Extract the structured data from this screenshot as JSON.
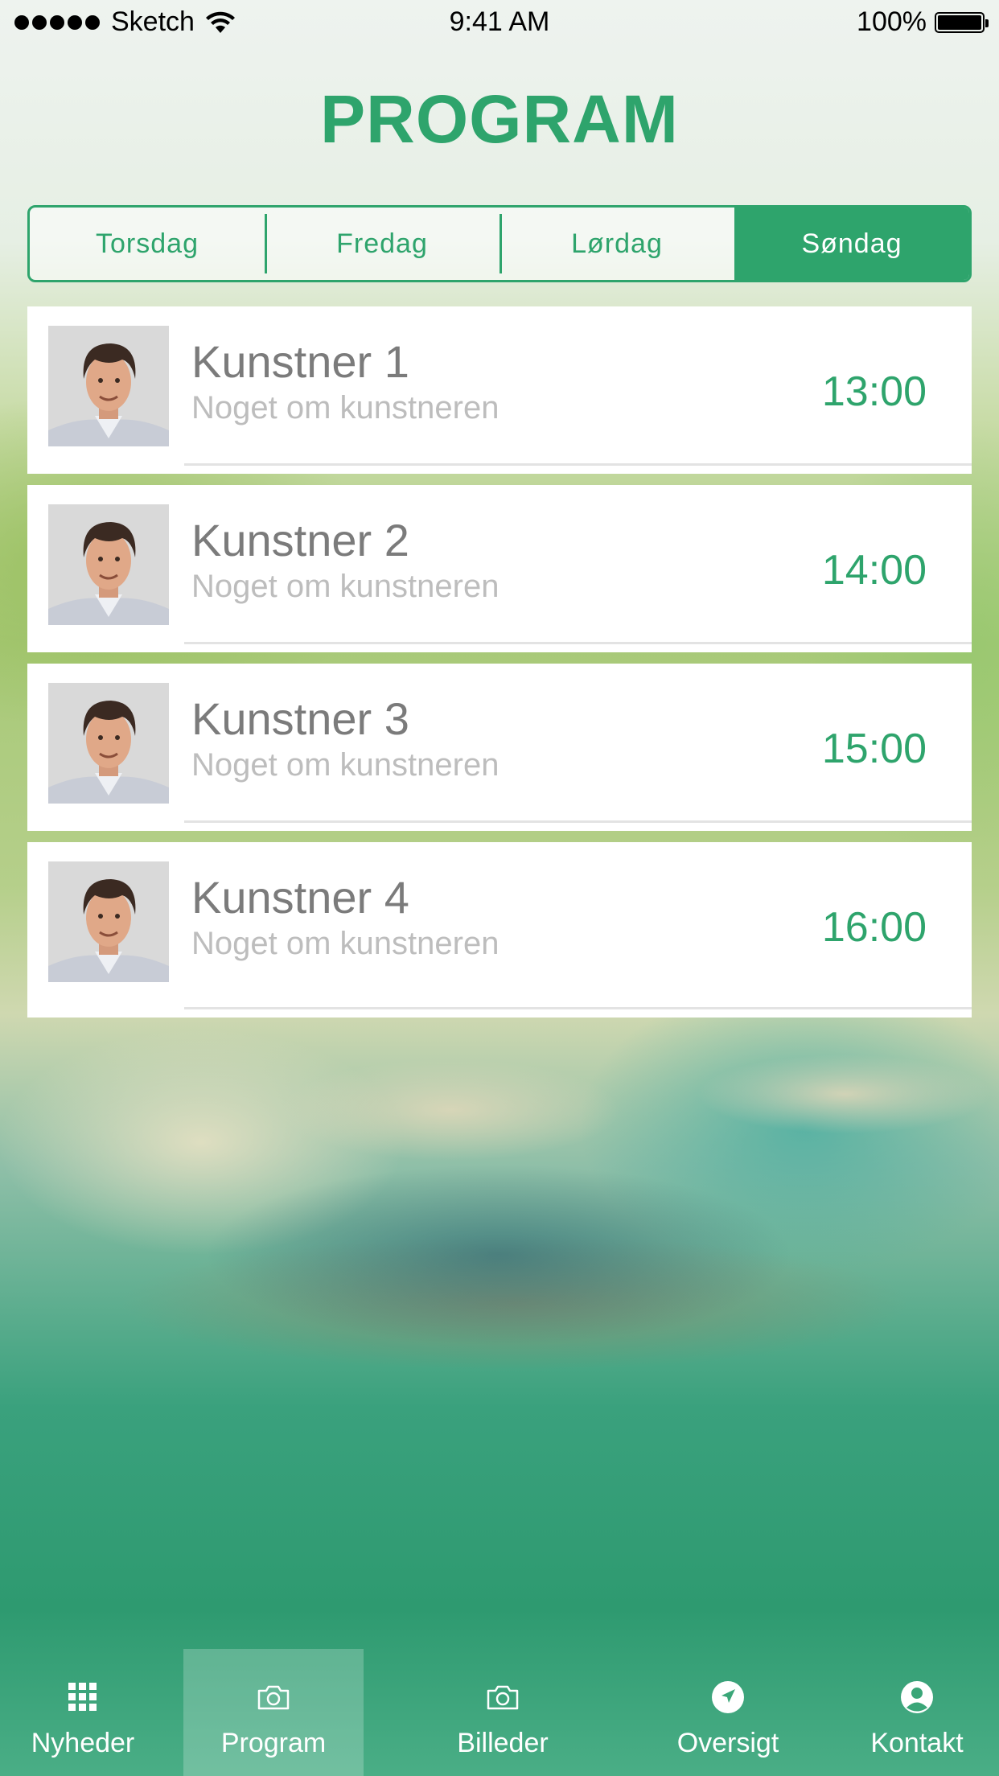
{
  "status_bar": {
    "carrier": "Sketch",
    "time": "9:41 AM",
    "battery": "100%",
    "battery_level": 1.0
  },
  "header": {
    "title": "PROGRAM"
  },
  "day_tabs": {
    "items": [
      {
        "label": "Torsdag",
        "active": false
      },
      {
        "label": "Fredag",
        "active": false
      },
      {
        "label": "Lørdag",
        "active": false
      },
      {
        "label": "Søndag",
        "active": true
      }
    ]
  },
  "program": {
    "items": [
      {
        "name": "Kunstner 1",
        "description": "Noget om kunstneren",
        "time": "13:00",
        "image": "artist-photo"
      },
      {
        "name": "Kunstner 2",
        "description": "Noget om kunstneren",
        "time": "14:00",
        "image": "artist-photo"
      },
      {
        "name": "Kunstner 3",
        "description": "Noget om kunstneren",
        "time": "15:00",
        "image": "artist-photo"
      },
      {
        "name": "Kunstner 4",
        "description": "Noget om kunstneren",
        "time": "16:00",
        "image": "artist-photo"
      }
    ]
  },
  "tab_bar": {
    "items": [
      {
        "label": "Nyheder",
        "icon": "grid-icon",
        "active": false
      },
      {
        "label": "Program",
        "icon": "camera-icon",
        "active": true
      },
      {
        "label": "Billeder",
        "icon": "camera-icon",
        "active": false
      },
      {
        "label": "Oversigt",
        "icon": "location-arrow-icon",
        "active": false
      },
      {
        "label": "Kontakt",
        "icon": "user-circle-icon",
        "active": false
      }
    ]
  },
  "colors": {
    "accent": "#2ea46c",
    "name_text": "#7b7b7b",
    "description_text": "#bdbdbd"
  }
}
